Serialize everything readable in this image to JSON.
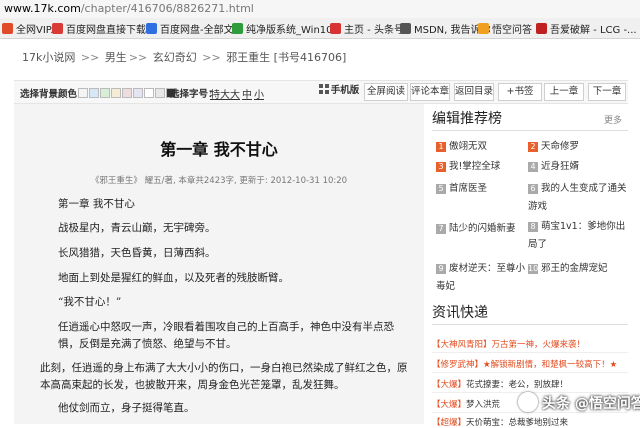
{
  "browser": {
    "url_host": "www.17k.com",
    "url_rest": "/chapter/416706/8826271.html",
    "bookmarks": [
      {
        "label": "全网VIP...",
        "color": "#e04b2a"
      },
      {
        "label": "百度网盘直接下载...",
        "color": "#d93a36"
      },
      {
        "label": "百度网盘-全部文件",
        "color": "#2f6fe0"
      },
      {
        "label": "纯净版系统_Win10...",
        "color": "#2e9c3c"
      },
      {
        "label": "主页 - 头条号",
        "color": "#d83232"
      },
      {
        "label": "MSDN, 我告诉你",
        "color": "#555555"
      },
      {
        "label": "悟空问答",
        "color": "#f0a020"
      },
      {
        "label": "吾爱破解 - LCG -...",
        "color": "#c02020"
      }
    ]
  },
  "breadcrumb": {
    "items": [
      "17k小说网",
      "男生",
      "玄幻奇幻",
      "邪王重生 [书号416706]"
    ],
    "separator": ">>"
  },
  "toolbar": {
    "bg_label": "选择背景颜色：",
    "swatches": [
      "#f4f4f4",
      "#d6e8f5",
      "#d7efd7",
      "#f5ecd6",
      "#efdcdc",
      "#e4e4f5",
      "#ffffff",
      "#e8e8e8",
      "#333333"
    ],
    "font_label": "选择字号：",
    "font_sizes": [
      "特大",
      "大",
      "中",
      "小"
    ],
    "mobile": "手机版",
    "fullscreen": "全屏阅读",
    "comments": "评论本章",
    "back": "返回目录",
    "bookmark": "+书签",
    "prev": "上一章",
    "next": "下一章"
  },
  "chapter": {
    "title": "第一章 我不甘心",
    "meta": "《邪王重生》 耀五/著, 本章共2423字, 更新于: 2012-10-31 10:20",
    "paragraphs": [
      "第一章 我不甘心",
      "战极星内，青云山巅，无宇碑旁。",
      "长风猎猎，天色昏黄，日薄西斜。",
      "地面上到处是猩红的鲜血，以及死者的残肢断臂。",
      "“我不甘心！”",
      "任逍遥心中怒叹一声，冷眼看着围攻自己的上百高手，神色中没有半点恐惧，反倒是充满了愤怒、绝望与不甘。",
      "此刻，任逍遥的身上布满了大大小小的伤口，一身白袍已然染成了鲜红之色，原本高高束起的长发，也披散开来，周身金色光芒笼罩，乱发狂舞。",
      "他仗剑而立，身子挺得笔直。"
    ]
  },
  "recommend": {
    "title": "编辑推荐榜",
    "more": "更多",
    "items": [
      {
        "num": "1",
        "title": "傲翊无双"
      },
      {
        "num": "2",
        "title": "天命修罗"
      },
      {
        "num": "3",
        "title": "我!掌控全球"
      },
      {
        "num": "4",
        "title": "近身狂婿"
      },
      {
        "num": "5",
        "title": "首席医圣"
      },
      {
        "num": "6",
        "title": "我的人生变成了通关游戏"
      },
      {
        "num": "7",
        "title": "陆少的闪婚新妻"
      },
      {
        "num": "8",
        "title": "萌宝1v1：爹地你出局了"
      },
      {
        "num": "9",
        "title": "废材逆天：至尊小毒妃"
      },
      {
        "num": "10",
        "title": "邪王的金牌宠妃"
      }
    ]
  },
  "news": {
    "title": "资讯快递",
    "items": [
      {
        "tag": "【大神风青阳】",
        "text": "万古第一神，火爆来袭！",
        "red": true
      },
      {
        "tag": "【修罗武神】",
        "text": "★解锁新剧情，和楚枫一较高下！★",
        "red": true
      },
      {
        "tag": "【大爆】",
        "text": "花式撩妻：老公，别放肆！",
        "red": false
      },
      {
        "tag": "【大爆】",
        "text": "梦入洪荒",
        "red": false
      },
      {
        "tag": "【超爆】",
        "text": "天价萌宝：总裁爹地别过来",
        "red": false
      }
    ]
  },
  "watermark": "头条 @悟空问答"
}
